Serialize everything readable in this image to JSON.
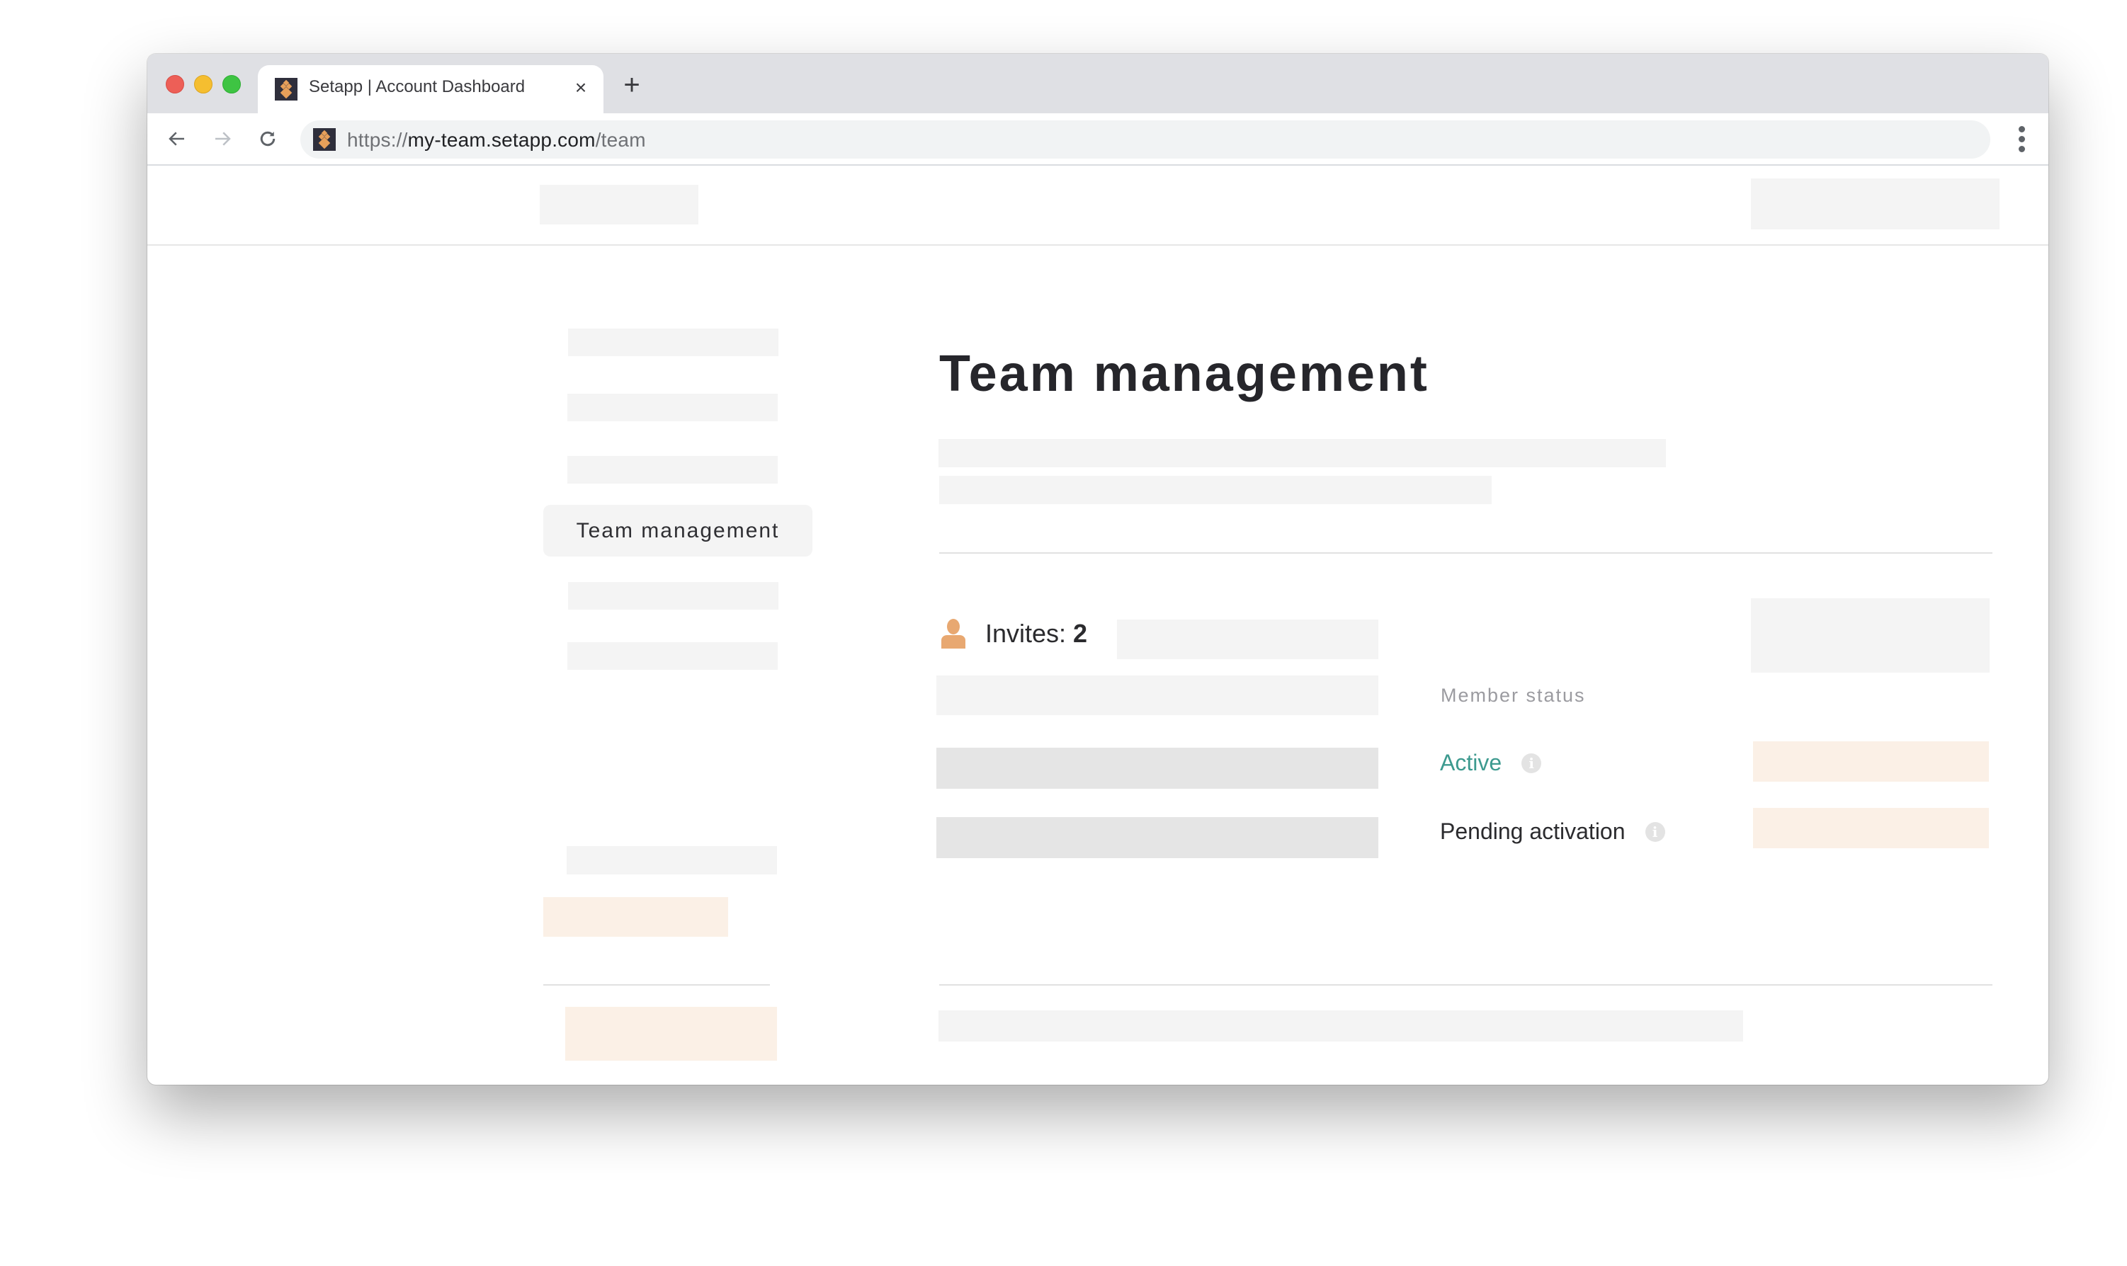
{
  "browser": {
    "tab_title": "Setapp | Account Dashboard",
    "tab_close_icon": "×",
    "new_tab_icon": "+",
    "url_scheme": "https://",
    "url_host": "my-team.setapp.com",
    "url_path": "/team",
    "favicon": "setapp-logo-icon"
  },
  "sidebar": {
    "active_item": "Team management"
  },
  "main": {
    "title": "Team management",
    "invites_label": "Invites:",
    "invites_count": "2",
    "member_status_heading": "Member status",
    "statuses": [
      {
        "label": "Active",
        "color": "#3d9a8f",
        "info_icon": "i"
      },
      {
        "label": "Pending activation",
        "color": "#2b2b2e",
        "info_icon": "i"
      }
    ]
  },
  "colors": {
    "accent_orange": "#e8a871",
    "skeleton": "#f4f4f4",
    "skeleton_dark": "#e5e5e5",
    "skeleton_peach": "#fbf0e6"
  }
}
